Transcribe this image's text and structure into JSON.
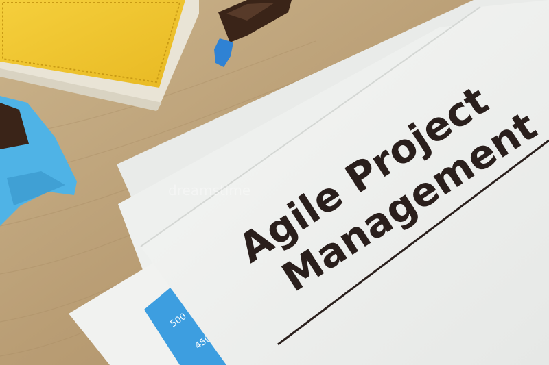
{
  "document": {
    "title_line_1": "Agile Project",
    "title_line_2": "Management"
  },
  "chart_sheet": {
    "tick_1": "500",
    "tick_2": "450"
  },
  "watermark": "dreamstime",
  "colors": {
    "wood": "#c2a880",
    "paper": "#f2f3f1",
    "notebook_cover": "#f2c832",
    "marker_body": "#3a2418",
    "marker_cap": "#2f82d4",
    "holder_blue": "#4fb3e6",
    "chart_blue": "#3d9ee0",
    "text_dark": "#2a1f1c"
  }
}
